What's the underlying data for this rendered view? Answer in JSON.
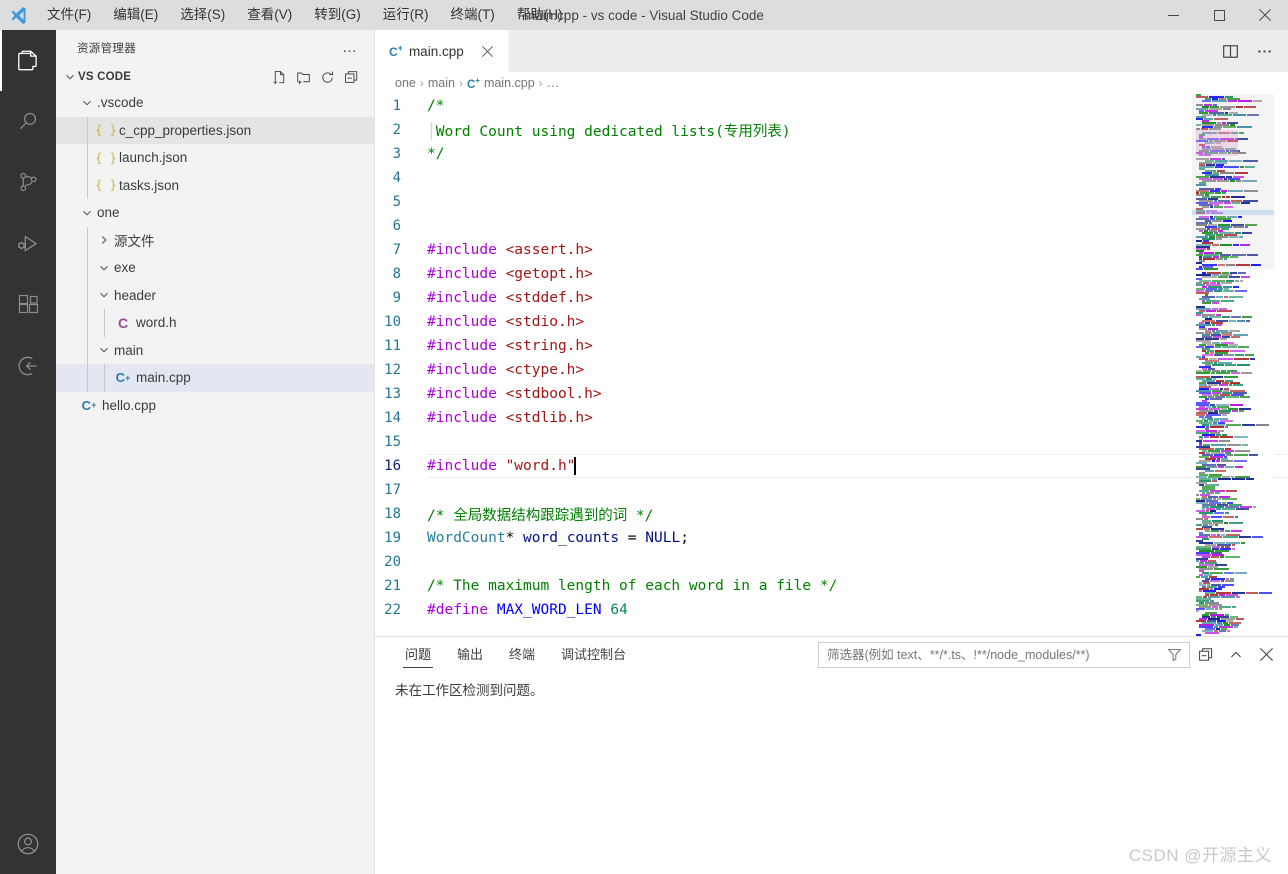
{
  "titlebar": {
    "app_icon": "vscode-logo-icon",
    "menus": [
      {
        "label": "文件(F)",
        "mnemonic": "F"
      },
      {
        "label": "编辑(E)",
        "mnemonic": "E"
      },
      {
        "label": "选择(S)",
        "mnemonic": "S"
      },
      {
        "label": "查看(V)",
        "mnemonic": "V"
      },
      {
        "label": "转到(G)",
        "mnemonic": "G"
      },
      {
        "label": "运行(R)",
        "mnemonic": "R"
      },
      {
        "label": "终端(T)",
        "mnemonic": "T"
      },
      {
        "label": "帮助(H)",
        "mnemonic": "H"
      }
    ],
    "title": "main.cpp - vs code - Visual Studio Code",
    "window_controls": [
      "minimize-icon",
      "maximize-icon",
      "close-icon"
    ]
  },
  "activitybar": {
    "items": [
      {
        "name": "explorer",
        "icon": "files-icon",
        "active": true
      },
      {
        "name": "search",
        "icon": "search-icon",
        "active": false
      },
      {
        "name": "source-control",
        "icon": "source-control-icon",
        "active": false
      },
      {
        "name": "run-debug",
        "icon": "run-and-debug-icon",
        "active": false
      },
      {
        "name": "extensions",
        "icon": "extensions-icon",
        "active": false
      },
      {
        "name": "remote-explorer",
        "icon": "remote-explorer-icon",
        "active": false
      }
    ],
    "bottom_items": [
      {
        "name": "accounts",
        "icon": "account-icon"
      }
    ]
  },
  "sidebar": {
    "title": "资源管理器",
    "more_actions": "…",
    "section": {
      "label": "VS CODE",
      "expanded": true,
      "actions": [
        "new-file-icon",
        "new-folder-icon",
        "refresh-icon",
        "collapse-all-icon"
      ]
    },
    "tree": [
      {
        "label": ".vscode",
        "kind": "folder",
        "depth": 1,
        "expanded": true,
        "icon": "chevron-down-icon",
        "state": "normal"
      },
      {
        "label": "c_cpp_properties.json",
        "kind": "json",
        "depth": 2,
        "icon": "json-braces-icon",
        "state": "greyed"
      },
      {
        "label": "launch.json",
        "kind": "json",
        "depth": 2,
        "icon": "json-braces-icon",
        "state": "normal"
      },
      {
        "label": "tasks.json",
        "kind": "json",
        "depth": 2,
        "icon": "json-braces-icon",
        "state": "normal"
      },
      {
        "label": "one",
        "kind": "folder",
        "depth": 1,
        "expanded": true,
        "icon": "chevron-down-icon",
        "state": "normal"
      },
      {
        "label": "源文件",
        "kind": "folder",
        "depth": 2,
        "expanded": false,
        "icon": "chevron-right-icon",
        "state": "normal"
      },
      {
        "label": "exe",
        "kind": "folder",
        "depth": 2,
        "expanded": true,
        "icon": "chevron-down-icon",
        "state": "normal"
      },
      {
        "label": "header",
        "kind": "folder",
        "depth": 2,
        "expanded": true,
        "icon": "chevron-down-icon",
        "state": "normal"
      },
      {
        "label": "word.h",
        "kind": "c-header",
        "depth": 3,
        "icon": "c-file-icon",
        "state": "normal"
      },
      {
        "label": "main",
        "kind": "folder",
        "depth": 2,
        "expanded": true,
        "icon": "chevron-down-icon",
        "state": "normal"
      },
      {
        "label": "main.cpp",
        "kind": "cpp",
        "depth": 3,
        "icon": "cpp-file-icon",
        "state": "selected"
      },
      {
        "label": "hello.cpp",
        "kind": "cpp",
        "depth": 1,
        "icon": "cpp-file-icon",
        "state": "normal"
      }
    ]
  },
  "editor": {
    "tabs": [
      {
        "label": "main.cpp",
        "icon": "cpp-file-icon",
        "active": true,
        "close": "close-icon"
      }
    ],
    "tab_actions": [
      "split-editor-icon",
      "more-actions-icon"
    ],
    "breadcrumb": [
      {
        "label": "one",
        "icon": ""
      },
      {
        "label": "main",
        "icon": ""
      },
      {
        "label": "main.cpp",
        "icon": "cpp-file-icon"
      },
      {
        "label": "…",
        "icon": ""
      }
    ],
    "breadcrumb_separator": "›",
    "cursor_line": 16,
    "lines": [
      {
        "n": 1,
        "tokens": [
          {
            "t": "/*",
            "c": "cm"
          }
        ]
      },
      {
        "n": 2,
        "tokens": [
          {
            "t": "  ",
            "c": "op"
          },
          {
            "t": "Word Count using dedicated lists(专用列表)",
            "c": "cm"
          }
        ],
        "indent_guide": true
      },
      {
        "n": 3,
        "tokens": [
          {
            "t": "*/",
            "c": "cm"
          }
        ]
      },
      {
        "n": 4,
        "tokens": []
      },
      {
        "n": 5,
        "tokens": []
      },
      {
        "n": 6,
        "tokens": []
      },
      {
        "n": 7,
        "tokens": [
          {
            "t": "#include",
            "c": "pp"
          },
          {
            "t": " ",
            "c": "op"
          },
          {
            "t": "<assert.h>",
            "c": "str"
          }
        ]
      },
      {
        "n": 8,
        "tokens": [
          {
            "t": "#include",
            "c": "pp"
          },
          {
            "t": " ",
            "c": "op"
          },
          {
            "t": "<getopt.h>",
            "c": "str"
          }
        ]
      },
      {
        "n": 9,
        "tokens": [
          {
            "t": "#include",
            "c": "pp"
          },
          {
            "t": " ",
            "c": "op"
          },
          {
            "t": "<stddef.h>",
            "c": "str"
          }
        ]
      },
      {
        "n": 10,
        "tokens": [
          {
            "t": "#include",
            "c": "pp"
          },
          {
            "t": " ",
            "c": "op"
          },
          {
            "t": "<stdio.h>",
            "c": "str"
          }
        ]
      },
      {
        "n": 11,
        "tokens": [
          {
            "t": "#include",
            "c": "pp"
          },
          {
            "t": " ",
            "c": "op"
          },
          {
            "t": "<string.h>",
            "c": "str"
          }
        ]
      },
      {
        "n": 12,
        "tokens": [
          {
            "t": "#include",
            "c": "pp"
          },
          {
            "t": " ",
            "c": "op"
          },
          {
            "t": "<ctype.h>",
            "c": "str"
          }
        ]
      },
      {
        "n": 13,
        "tokens": [
          {
            "t": "#include",
            "c": "pp"
          },
          {
            "t": " ",
            "c": "op"
          },
          {
            "t": "<stdbool.h>",
            "c": "str"
          }
        ]
      },
      {
        "n": 14,
        "tokens": [
          {
            "t": "#include",
            "c": "pp"
          },
          {
            "t": " ",
            "c": "op"
          },
          {
            "t": "<stdlib.h>",
            "c": "str"
          }
        ]
      },
      {
        "n": 15,
        "tokens": []
      },
      {
        "n": 16,
        "tokens": [
          {
            "t": "#include",
            "c": "pp"
          },
          {
            "t": " ",
            "c": "op"
          },
          {
            "t": "\"word.h\"",
            "c": "str"
          }
        ],
        "current": true,
        "caret": true
      },
      {
        "n": 17,
        "tokens": []
      },
      {
        "n": 18,
        "tokens": [
          {
            "t": "/* 全局数据结构跟踪遇到的词 */",
            "c": "cm"
          }
        ]
      },
      {
        "n": 19,
        "tokens": [
          {
            "t": "WordCount",
            "c": "typ"
          },
          {
            "t": "* ",
            "c": "op"
          },
          {
            "t": "word_counts",
            "c": "idn"
          },
          {
            "t": " = ",
            "c": "op"
          },
          {
            "t": "NULL",
            "c": "idn"
          },
          {
            "t": ";",
            "c": "op"
          }
        ]
      },
      {
        "n": 20,
        "tokens": []
      },
      {
        "n": 21,
        "tokens": [
          {
            "t": "/* The maximum length of each word in a file */",
            "c": "cm"
          }
        ]
      },
      {
        "n": 22,
        "tokens": [
          {
            "t": "#define",
            "c": "pp"
          },
          {
            "t": " ",
            "c": "op"
          },
          {
            "t": "MAX_WORD_LEN",
            "c": "mac"
          },
          {
            "t": " ",
            "c": "op"
          },
          {
            "t": "64",
            "c": "num"
          }
        ]
      }
    ]
  },
  "panel": {
    "tabs": [
      {
        "label": "问题",
        "active": true
      },
      {
        "label": "输出",
        "active": false
      },
      {
        "label": "终端",
        "active": false
      },
      {
        "label": "调试控制台",
        "active": false
      }
    ],
    "filter": {
      "value": "",
      "placeholder": "筛选器(例如 text、**/*.ts、!**/node_modules/**)",
      "icon": "filter-icon"
    },
    "actions": [
      "clear-icon",
      "collapse-panel-icon",
      "close-panel-icon"
    ],
    "empty_message": "未在工作区检测到问题。"
  },
  "watermark": "CSDN @开源主义",
  "colors": {
    "titlebar_bg": "#dddddd",
    "activitybar_bg": "#333333",
    "sidebar_bg": "#f3f3f3",
    "editor_bg": "#ffffff",
    "tabsbar_bg": "#ececec",
    "selection_bg": "#e4e6f1",
    "linenumber": "#237893",
    "comment": "#008000",
    "preprocessor": "#af00db",
    "string": "#a31515",
    "type": "#267f99",
    "identifier": "#001080",
    "keyword": "#0000ff",
    "number": "#098658"
  }
}
